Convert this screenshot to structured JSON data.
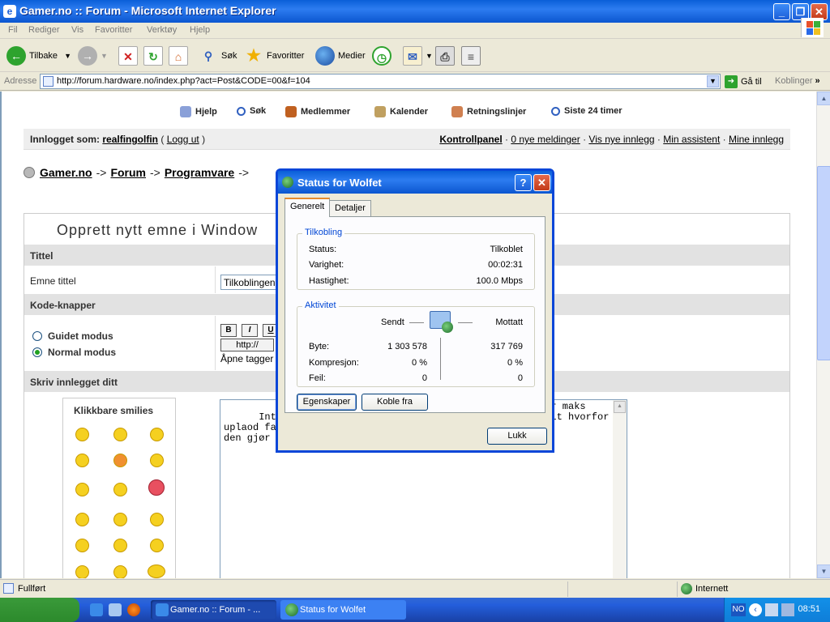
{
  "window": {
    "title": "Gamer.no :: Forum - Microsoft Internet Explorer",
    "minimize": "_",
    "restore": "❐",
    "close": "✕"
  },
  "menu": [
    "Fil",
    "Rediger",
    "Vis",
    "Favoritter",
    "Verktøy",
    "Hjelp"
  ],
  "toolbar": {
    "back": "Tilbake",
    "search": "Søk",
    "favorites": "Favoritter",
    "media": "Medier"
  },
  "address": {
    "label": "Adresse",
    "url": "http://forum.hardware.no/index.php?act=Post&CODE=00&f=104",
    "go": "Gå til",
    "links": "Koblinger"
  },
  "page": {
    "topnav": [
      "Hjelp",
      "Søk",
      "Medlemmer",
      "Kalender",
      "Retningslinjer",
      "Siste 24 timer"
    ],
    "logged_in_label": "Innlogget som:",
    "username": "realfingolfin",
    "logout": "Logg ut",
    "user_links": [
      "Kontrollpanel",
      "0 nye meldinger",
      "Vis nye innlegg",
      "Min assistent",
      "Mine innlegg"
    ],
    "breadcrumb": [
      "Gamer.no",
      "Forum",
      "Programvare"
    ],
    "breadcrumb_sep": "->",
    "form_title": "Opprett nytt emne i Window",
    "section_title": "Tittel",
    "topic_title_label": "Emne tittel",
    "topic_title_value": "Tilkoblingen",
    "section_code": "Kode-knapper",
    "radio_guided": "Guidet modus",
    "radio_normal": "Normal modus",
    "code_buttons": [
      "B",
      "I",
      "U"
    ],
    "http_button": "http://",
    "hint": "Åpne tagger",
    "section_post": "Skriv innlegget ditt",
    "smilies_title": "Klikkbare smilies",
    "post_text_left": "Internett-till\nuplaod fart,\nden gjør det",
    "post_text_right": "ter maks\nveit hvorfor"
  },
  "dialog": {
    "title": "Status for Wolfet",
    "help": "?",
    "close": "✕",
    "tabs": [
      "Generelt",
      "Detaljer"
    ],
    "connection_group": "Tilkobling",
    "status_label": "Status:",
    "status_value": "Tilkoblet",
    "duration_label": "Varighet:",
    "duration_value": "00:02:31",
    "speed_label": "Hastighet:",
    "speed_value": "100.0 Mbps",
    "activity_group": "Aktivitet",
    "sent": "Sendt",
    "received": "Mottatt",
    "bytes_label": "Byte:",
    "bytes_sent": "1 303 578",
    "bytes_received": "317 769",
    "compression_label": "Kompresjon:",
    "compression_sent": "0 %",
    "compression_received": "0 %",
    "errors_label": "Feil:",
    "errors_sent": "0",
    "errors_received": "0",
    "properties_button": "Egenskaper",
    "disconnect_button": "Koble fra",
    "close_button": "Lukk"
  },
  "statusbar": {
    "left": "Fullført",
    "zone": "Internett"
  },
  "taskbar": {
    "tasks": [
      "Gamer.no :: Forum - ...",
      "Status for Wolfet"
    ],
    "tray_lang": "NO",
    "clock": "08:51"
  }
}
